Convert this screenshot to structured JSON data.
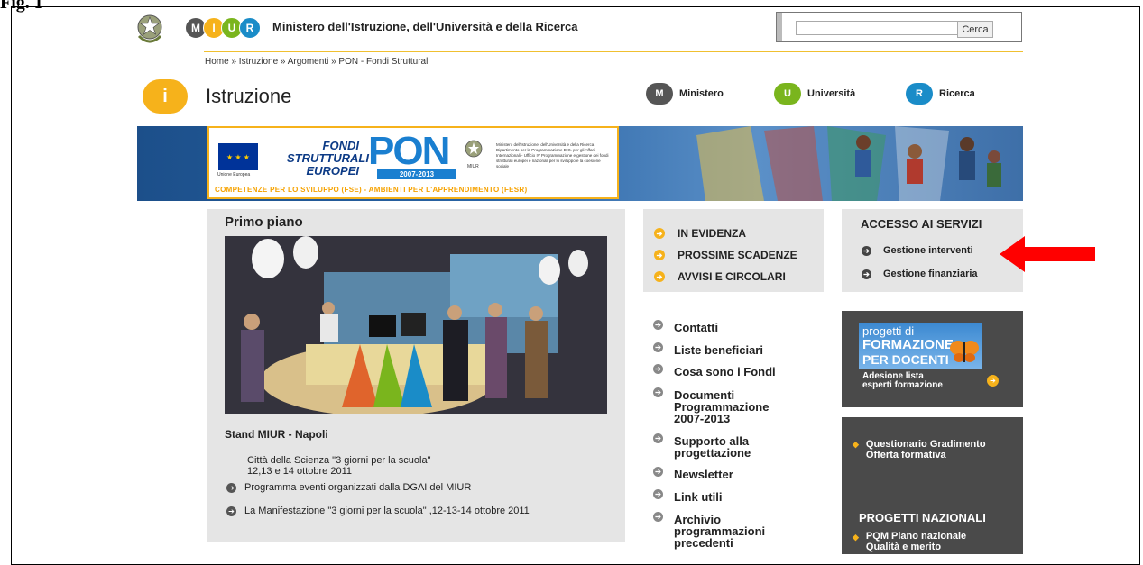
{
  "figure_label": "Fig. 1",
  "header": {
    "site_name": "Ministero dell'Istruzione, dell'Università e della Ricerca",
    "logo_letters": [
      "M",
      "I",
      "U",
      "R"
    ],
    "search": {
      "value": "",
      "button": "Cerca"
    }
  },
  "breadcrumb": "Home » Istruzione » Argomenti » PON - Fondi Strutturali",
  "section": {
    "icon_letter": "i",
    "title": "Istruzione",
    "nav": [
      {
        "letter": "M",
        "label": "Ministero",
        "color": "#555555"
      },
      {
        "letter": "U",
        "label": "Università",
        "color": "#7ab51d"
      },
      {
        "letter": "R",
        "label": "Ricerca",
        "color": "#1a8cc8"
      }
    ]
  },
  "banner": {
    "eu_caption": "Unione Europea",
    "fondi_lines": [
      "FONDI",
      "STRUTTURALI",
      "EUROPEI"
    ],
    "pon": "PON",
    "years": "2007-2013",
    "miur_caption": "MIUR",
    "ministry_text": "Ministero dell'Istruzione, dell'Università e della Ricerca Dipartimento per la Programmazione D.G. per gli Affari Internazionali - Ufficio IV Programmazione e gestione dei fondi strutturali europei e nazionali per lo sviluppo e la coesione sociale",
    "footer": "COMPETENZE PER LO SVILUPPO (FSE) - AMBIENTI PER L'APPRENDIMENTO (FESR)"
  },
  "primo_piano": {
    "title": "Primo piano",
    "stand_title": "Stand MIUR - Napoli",
    "event_lines": [
      "Città della Scienza \"3 giorni per la scuola\"",
      "12,13 e 14 ottobre 2011"
    ],
    "links": [
      "Programma eventi organizzati dalla DGAI del MIUR",
      "La Manifestazione \"3 giorni per la scuola\" ,12-13-14 ottobre 2011"
    ]
  },
  "evidenza": [
    "IN EVIDENZA",
    "PROSSIME SCADENZE",
    "AVVISI E CIRCOLARI"
  ],
  "links": [
    {
      "label": "Contatti"
    },
    {
      "label": "Liste beneficiari"
    },
    {
      "label": "Cosa sono i Fondi"
    },
    {
      "label": "Documenti Programmazione 2007-2013"
    },
    {
      "label": "Supporto alla progettazione"
    },
    {
      "label": "Newsletter"
    },
    {
      "label": "Link utili"
    },
    {
      "label": "Archivio programmazioni precedenti"
    }
  ],
  "accesso": {
    "title": "ACCESSO AI SERVIZI",
    "items": [
      "Gestione interventi",
      "Gestione finanziaria"
    ]
  },
  "promo_formazione": {
    "line1": "progetti di",
    "line2": "FORMAZIONE",
    "line3": "PER DOCENTI",
    "caption1": "Adesione lista",
    "caption2": "esperti formazione"
  },
  "promo_questionario": "Questionario Gradimento Offerta formativa",
  "progetti_nazionali": {
    "title": "PROGETTI NAZIONALI",
    "item": "PQM Piano nazionale Qualità e merito"
  },
  "colors": {
    "accent": "#f6b21b",
    "dark_box": "#4a4a4a",
    "light_box": "#e5e5e5",
    "arrow": "#ff0000"
  }
}
